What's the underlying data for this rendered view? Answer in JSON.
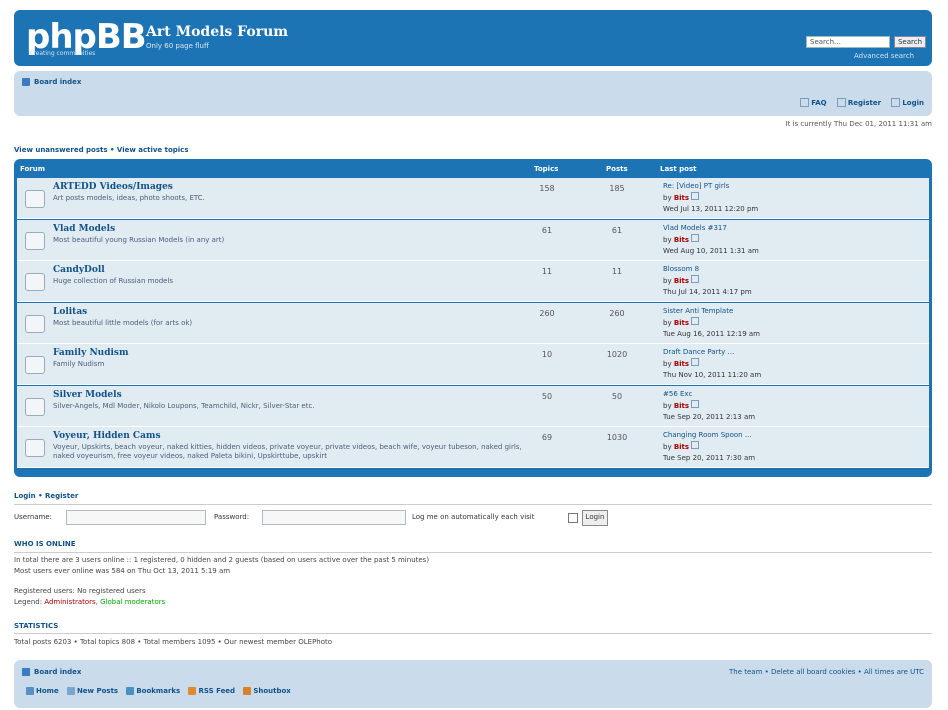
{
  "header": {
    "logo": "phpBB",
    "logo_tagline": "creating communities",
    "title": "Art Models Forum",
    "subtitle": "Only 60 page fluff",
    "search_placeholder": "Search…",
    "search_button": "Search",
    "advanced_search": "Advanced search"
  },
  "navbar": {
    "breadcrumb": "Board index",
    "links": [
      "FAQ",
      "Register",
      "Login"
    ]
  },
  "datetime": "It is currently Thu Dec 01, 2011 11:31 am",
  "unanswered": "View unanswered posts • View active topics",
  "forum_table": {
    "headers": {
      "forum": "Forum",
      "topics": "Topics",
      "posts": "Posts",
      "last_post": "Last post"
    },
    "rows": [
      {
        "title": "ARTEDD Videos/Images",
        "desc": "Art posts models, ideas, photo shoots, ETC.",
        "topics": "158",
        "posts": "185",
        "last_title": "Re: [Video] PT girls",
        "last_by": "Bits",
        "last_date": "Wed Jul 13, 2011 12:20 pm"
      },
      {
        "title": "Vlad Models",
        "desc": "Most beautiful young Russian Models (in any art)",
        "topics": "61",
        "posts": "61",
        "last_title": "Vlad Models #317",
        "last_by": "Bits",
        "last_date": "Wed Aug 10, 2011 1:31 am"
      },
      {
        "title": "CandyDoll",
        "desc": "Huge collection of Russian models",
        "topics": "11",
        "posts": "11",
        "last_title": "Blossom 8",
        "last_by": "Bits",
        "last_date": "Thu Jul 14, 2011 4:17 pm"
      },
      {
        "title": "Lolitas",
        "desc": "Most beautiful little models (for arts ok)",
        "topics": "260",
        "posts": "260",
        "last_title": "Sister Anti Template",
        "last_by": "Bits",
        "last_date": "Tue Aug 16, 2011 12:19 am"
      },
      {
        "title": "Family Nudism",
        "desc": "Family Nudism",
        "topics": "10",
        "posts": "1020",
        "last_title": "Draft Dance Party ...",
        "last_by": "Bits",
        "last_date": "Thu Nov 10, 2011 11:20 am"
      },
      {
        "title": "Silver Models",
        "desc": "Silver-Angels, Mdl Moder, Nikolo Loupons, Teamchild, Nickr, Silver-Star etc.",
        "topics": "50",
        "posts": "50",
        "last_title": "#56 Exc",
        "last_by": "Bits",
        "last_date": "Tue Sep 20, 2011 2:13 am"
      },
      {
        "title": "Voyeur, Hidden Cams",
        "desc": "Voyeur, Upskirts, beach voyeur, naked kitties, hidden videos, private voyeur, private videos, beach wife, voyeur tubeson, naked girls, naked voyeurism, free voyeur videos, naked Paleta bikini, Upskirttube, upskirt",
        "topics": "69",
        "posts": "1030",
        "last_title": "Changing Room Spoon ...",
        "last_by": "Bits",
        "last_date": "Tue Sep 20, 2011 7:30 am"
      }
    ]
  },
  "login": {
    "title": "Login • Register",
    "username_label": "Username:",
    "password_label": "Password:",
    "remember_label": "Log me on automatically each visit",
    "button": "Login"
  },
  "online": {
    "title": "WHO IS ONLINE",
    "line1": "In total there are 3 users online :: 1 registered, 0 hidden and 2 guests (based on users active over the past 5 minutes)",
    "line2": "Most users ever online was 584 on Thu Oct 13, 2011 5:19 am",
    "line3": "Registered users: No registered users",
    "legend_label": "Legend:",
    "legend_admin": "Administrators",
    "legend_mod": "Global moderators"
  },
  "stats": {
    "title": "STATISTICS",
    "line": "Total posts 6203 • Total topics 808 • Total members 1095 • Our newest member OLEPhoto"
  },
  "footer": {
    "breadcrumb": "Board index",
    "right": "The team • Delete all board cookies • All times are UTC",
    "links": [
      "Home",
      "New Posts",
      "Bookmarks",
      "RSS Feed",
      "Shoutbox"
    ]
  },
  "colors": {
    "primary": "#1d74b4",
    "light": "#cadceb",
    "row": "#e1ebf2",
    "link": "#105289"
  }
}
